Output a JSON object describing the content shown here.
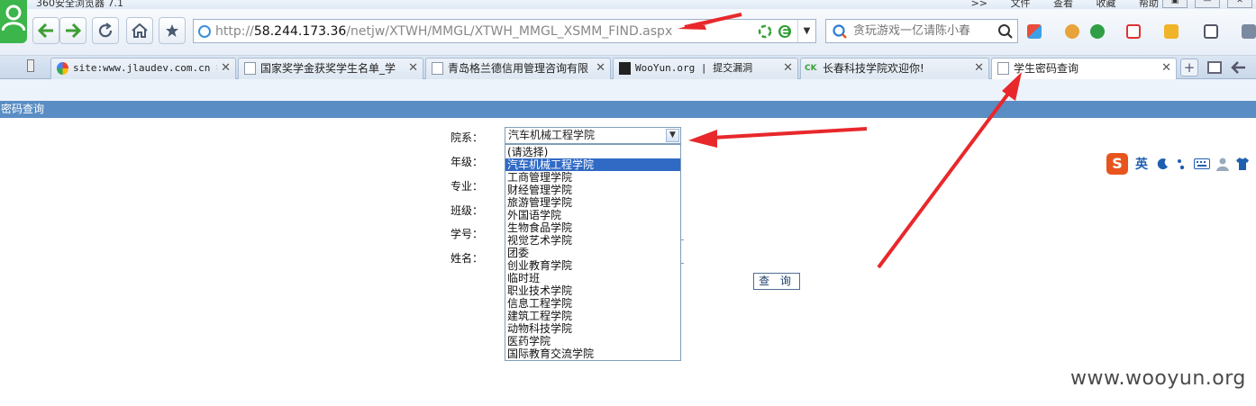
{
  "browser": {
    "app_title": "360安全浏览器 7.1",
    "menu": [
      ">>",
      "文件",
      "查看",
      "收藏",
      "帮助"
    ],
    "window_controls": [
      "▣",
      "—",
      "✕"
    ],
    "address": {
      "scheme": "http://",
      "host": "58.244.173.36",
      "path": "/netjw/XTWH/MMGL/XTWH_MMGL_XSMM_FIND.aspx"
    },
    "search_placeholder": "贪玩游戏一亿请陈小春",
    "tabs": [
      {
        "label": "site:www.jlaudev.com.cn 学",
        "icon": "google-icon"
      },
      {
        "label": "国家奖学金获奖学生名单_学",
        "icon": "page-icon"
      },
      {
        "label": "青岛格兰德信用管理咨询有限",
        "icon": "page-icon"
      },
      {
        "label": "WooYun.org | 提交漏洞",
        "icon": "wooyun-icon"
      },
      {
        "label": "长春科技学院欢迎你!",
        "icon": "ck-icon"
      },
      {
        "label": "学生密码查询",
        "icon": "page-icon",
        "active": true
      }
    ],
    "tab_close_glyph": "✕",
    "ck_badge": "CK"
  },
  "page": {
    "header": "密码查询",
    "form": {
      "labels": {
        "department": "院系：",
        "grade": "年级：",
        "major": "专业：",
        "class": "班级：",
        "student_id": "学号：",
        "name": "姓名："
      },
      "department_selected": "汽车机械工程学院",
      "department_options": [
        "(请选择)",
        "汽车机械工程学院",
        "工商管理学院",
        "财经管理学院",
        "旅游管理学院",
        "外国语学院",
        "生物食品学院",
        "视觉艺术学院",
        "团委",
        "创业教育学院",
        "临时班",
        "职业技术学院",
        "信息工程学院",
        "建筑工程学院",
        "动物科技学院",
        "医药学院",
        "国际教育交流学院"
      ],
      "highlighted_option": "汽车机械工程学院",
      "query_button": "查 询"
    }
  },
  "ime": {
    "logo": "S",
    "mode": "英"
  },
  "watermark": "www.wooyun.org",
  "colors": {
    "header_bar": "#5a8dc3",
    "selected_option": "#316ac5",
    "annotation_arrow": "#e8282b",
    "ime_logo": "#e8541e"
  }
}
